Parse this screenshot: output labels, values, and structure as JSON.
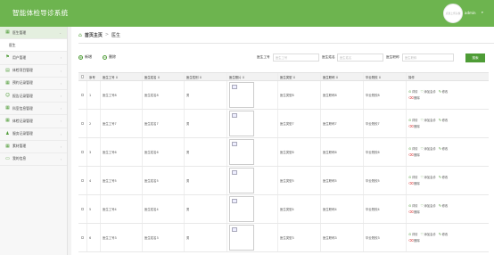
{
  "app": {
    "title": "智能体检导诊系统",
    "avatar_text": "点我上传头像",
    "user_name": "admin"
  },
  "sidebar": {
    "items": [
      {
        "label": "医生管理",
        "icon": "grid-icon",
        "active": true
      },
      {
        "label": "医生",
        "icon": "",
        "sub": true
      },
      {
        "label": "用户管理",
        "icon": "flag-icon"
      },
      {
        "label": "体检项目管理",
        "icon": "clipboard-icon"
      },
      {
        "label": "预约记录管理",
        "icon": "grid-icon"
      },
      {
        "label": "报告记录管理",
        "icon": "face-icon"
      },
      {
        "label": "科室信息管理",
        "icon": "grid-icon"
      },
      {
        "label": "体检记录管理",
        "icon": "grid-icon"
      },
      {
        "label": "服务记录管理",
        "icon": "user-icon"
      },
      {
        "label": "素材管理",
        "icon": "grid-icon"
      },
      {
        "label": "我的信息",
        "icon": "monitor-icon"
      }
    ]
  },
  "breadcrumb": {
    "home": "首页主页",
    "current": "医生"
  },
  "toolbar": {
    "add_label": "新增",
    "delete_label": "删除"
  },
  "search": {
    "fields": [
      {
        "label": "医生工号",
        "placeholder": "医生工号"
      },
      {
        "label": "医生姓名",
        "placeholder": "医生姓名"
      },
      {
        "label": "医生职称",
        "placeholder": "医生职称"
      }
    ],
    "button_label": "搜索"
  },
  "table": {
    "headers": [
      "序号",
      "医生工号 ↕",
      "医生姓名 ↕",
      "医生性别 ↕",
      "医生照片 ↕",
      "医生类型 ↕",
      "医生职称 ↕",
      "毕业院校 ↕",
      "操作"
    ],
    "rows": [
      {
        "no": "1",
        "id": "医生工号8",
        "name": "医生姓名8",
        "sex": "男",
        "type": "医生类型8",
        "title": "医生职称8",
        "school": "毕业院校8"
      },
      {
        "no": "2",
        "id": "医生工号7",
        "name": "医生姓名7",
        "sex": "男",
        "type": "医生类型7",
        "title": "医生职称7",
        "school": "毕业院校7"
      },
      {
        "no": "3",
        "id": "医生工号6",
        "name": "医生姓名6",
        "sex": "男",
        "type": "医生类型6",
        "title": "医生职称6",
        "school": "毕业院校6"
      },
      {
        "no": "4",
        "id": "医生工号5",
        "name": "医生姓名5",
        "sex": "男",
        "type": "医生类型5",
        "title": "医生职称5",
        "school": "毕业院校5"
      },
      {
        "no": "5",
        "id": "医生工号4",
        "name": "医生姓名4",
        "sex": "男",
        "type": "医生类型4",
        "title": "医生职称4",
        "school": "毕业院校4"
      },
      {
        "no": "6",
        "id": "医生工号3",
        "name": "医生姓名3",
        "sex": "男",
        "type": "医生类型3",
        "title": "医生职称3",
        "school": "毕业院校3"
      }
    ],
    "actions": {
      "detail": "详情",
      "fav": "添加会诊",
      "edit": "修改",
      "delete": "删除"
    }
  },
  "colors": {
    "header_bg": "#6db44f",
    "accent": "#4e9c36",
    "danger": "#dd4444"
  }
}
